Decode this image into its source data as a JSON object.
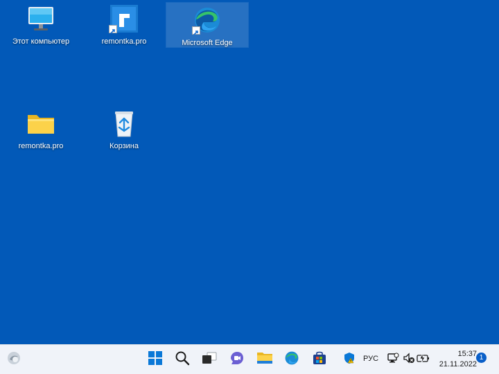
{
  "desktop": {
    "background_color": "#0259b8",
    "icons": [
      {
        "label": "Этот компьютер",
        "icon": "monitor-icon"
      },
      {
        "label": "remontka.pro",
        "icon": "remontka-app-icon",
        "shortcut": true
      },
      {
        "label": "Microsoft Edge",
        "icon": "edge-icon",
        "shortcut": true,
        "selected": true
      },
      {
        "label": "remontka.pro",
        "icon": "folder-icon"
      },
      {
        "label": "Корзина",
        "icon": "recycle-bin-icon"
      }
    ]
  },
  "taskbar": {
    "background_color": "#f0f3f9",
    "pinned": [
      "widgets-icon",
      "start-icon",
      "search-icon",
      "task-view-icon",
      "chat-icon",
      "file-explorer-icon",
      "edge-icon",
      "store-icon"
    ],
    "tray": {
      "language": "РУС",
      "time": "15:37",
      "date": "21.11.2022",
      "notification_count": "1"
    }
  }
}
